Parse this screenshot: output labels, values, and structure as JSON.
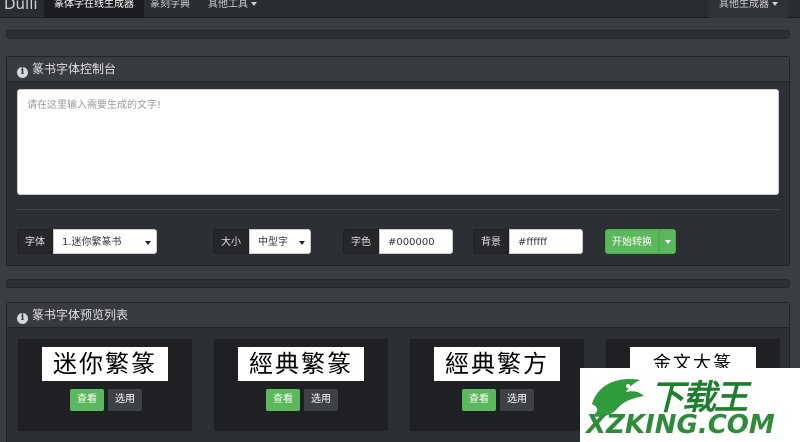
{
  "navbar": {
    "brand": "Dulli",
    "items": [
      {
        "label": "篆体字在线生成器",
        "active": true
      },
      {
        "label": "篆刻字典",
        "active": false
      },
      {
        "label": "其他工具",
        "active": false
      }
    ],
    "right_label": "其他生成器"
  },
  "console": {
    "title": "篆书字体控制台",
    "textarea_placeholder": "请在这里输入需要生成的文字!",
    "font_label": "字体",
    "font_value": "1.迷你繁篆书",
    "size_label": "大小",
    "size_value": "中型字",
    "color_label": "字色",
    "color_value": "#000000",
    "bg_label": "背景",
    "bg_value": "#ffffff",
    "convert_label": "开始转换"
  },
  "preview": {
    "title": "篆书字体预览列表",
    "cards": [
      {
        "sample": "迷你繁篆",
        "view": "查看",
        "pick": "选用"
      },
      {
        "sample": "經典繁篆",
        "view": "查看",
        "pick": "选用"
      },
      {
        "sample": "經典繁方",
        "view": "查看",
        "pick": "选用"
      },
      {
        "sample": "金文大篆",
        "view": "",
        "pick": ""
      }
    ]
  },
  "watermark": {
    "top": "下载王",
    "bottom": "XZKING.COM"
  },
  "colors": {
    "accent_green": "#5cb85c",
    "panel_bg": "#2c2f33",
    "page_bg": "#3a3d42"
  }
}
